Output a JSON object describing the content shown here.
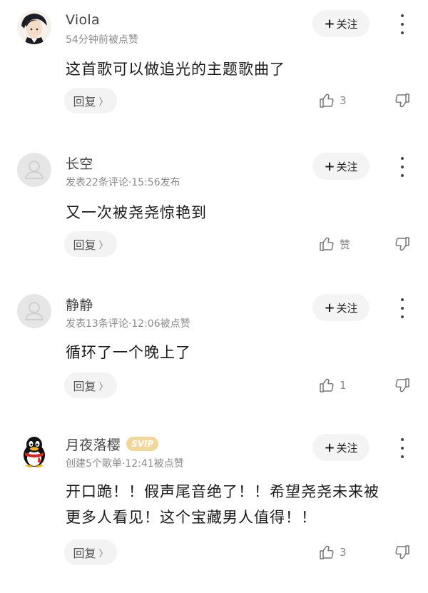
{
  "follow_label": "关注",
  "reply_label": "回复",
  "comments": [
    {
      "username": "Viola",
      "meta": "54分钟前被点赞",
      "text": "这首歌可以做追光的主题歌曲了",
      "like_count": "3",
      "avatar": "anime-portrait-avatar"
    },
    {
      "username": "长空",
      "meta": "发表22条评论·15:56发布",
      "text": "又一次被尧尧惊艳到",
      "like_count": "赞",
      "avatar": "default-user-avatar"
    },
    {
      "username": "静静",
      "meta": "发表13条评论·12:06被点赞",
      "text": "循环了一个晚上了",
      "like_count": "1",
      "avatar": "default-user-avatar"
    },
    {
      "username": "月夜落樱",
      "badge": "SVIP",
      "meta": "创建5个歌单·12:41被点赞",
      "text_lines": [
        "开口跪！！假声尾音绝了！！希望尧尧未来被",
        "更多人看见！这个宝藏男人值得！！"
      ],
      "like_count": "3",
      "avatar": "qq-penguin-avatar"
    }
  ]
}
